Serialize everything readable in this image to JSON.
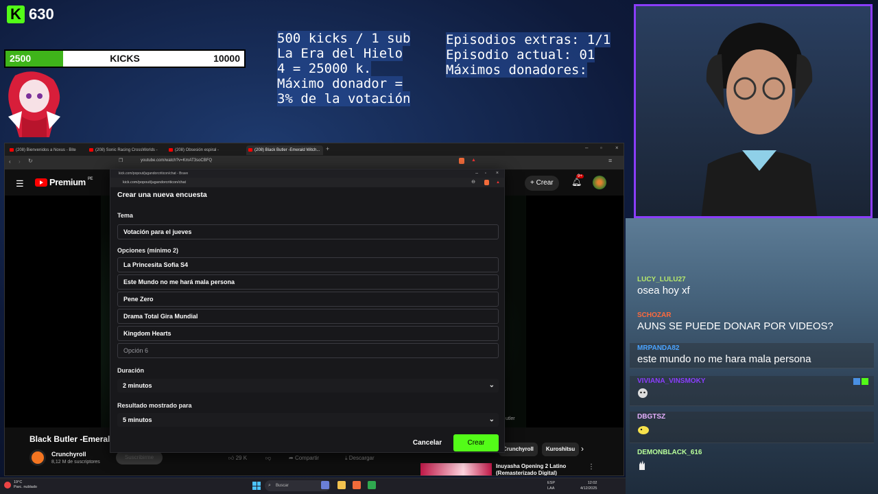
{
  "overlay": {
    "kick_count": "630",
    "goal": {
      "start": "2500",
      "label": "KICKS",
      "end": "10000",
      "progress": 0.24
    },
    "info_left": [
      "500 kicks / 1 sub",
      "La Era del Hielo",
      "4 = 25000 k.",
      "Máximo donador =",
      "3% de la votación"
    ],
    "info_right": [
      "Episodios extras: 1/1",
      "Episodio actual: 01",
      "Máximos donadores:"
    ]
  },
  "browser": {
    "tabs": [
      {
        "label": "(208) Bienvenidos a Noxus - Bite Me..."
      },
      {
        "label": "(208) Sonic Racing CrossWorlds - Co..."
      },
      {
        "label": "(208) Obsesión espiral - Frecuencia..."
      },
      {
        "label": "(208) Black Butler -Emerald Witch..."
      }
    ],
    "url": "youtube.com/watch?v=KmAT3soCBFQ"
  },
  "youtube": {
    "logo": "Premium",
    "logo_region": "PE",
    "create_label": "Crear",
    "notif_count": "9+",
    "video_title": "Black Butler -Emerald",
    "channel_name": "Crunchyroll",
    "channel_subs": "8,12 M de suscriptores",
    "subscribe_label": "Suscribirme",
    "likes": "29 K",
    "share_label": "Compartir",
    "download_label": "Descargar",
    "chips": [
      "Crunchyroll",
      "Kuroshitsu"
    ],
    "related_title": "Inuyasha Opening 2 Latino (Remasterizado Digital)",
    "video_side_text": "utler"
  },
  "popout": {
    "window_title": "kick.com/popout/jugandorcriticon/chat - Brave",
    "url": "kick.com/popout/jugandorcriticon/chat",
    "header": "Crear una nueva encuesta",
    "topic_label": "Tema",
    "topic_value": "Votación para el jueves",
    "options_label": "Opciones (mínimo 2)",
    "options": [
      "La Princesita Sofia S4",
      "Este Mundo no me hará mala persona",
      "Pene Zero",
      "Drama Total Gira Mundial",
      "Kingdom Hearts"
    ],
    "option_placeholder": "Opción 6",
    "duration_label": "Duración",
    "duration_value": "2 minutos",
    "result_label": "Resultado mostrado para",
    "result_value": "5 minutos",
    "cancel_label": "Cancelar",
    "create_label": "Crear"
  },
  "chat": {
    "messages": [
      {
        "user": "LUCY_LULU27",
        "text": "osea hoy xf",
        "color": "#b6e86b"
      },
      {
        "user": "SCHOZAR",
        "text": "AUNS SE PUEDE DONAR POR VIDEOS?",
        "color": "#ff6a3d"
      },
      {
        "user": "MRPANDA82",
        "text": "este mundo no me hara mala persona",
        "color": "#4aa3ff"
      },
      {
        "user": "VIVIANA_VINSMOKY",
        "text": "",
        "color": "#8b3dff"
      },
      {
        "user": "DBGTSZ",
        "text": "",
        "color": "#e6b0ff"
      },
      {
        "user": "DEMONBLACK_616",
        "text": "",
        "color": "#b8ff9a"
      }
    ]
  },
  "taskbar": {
    "weather_temp": "19°C",
    "weather_desc": "Parc. nublado",
    "search_placeholder": "Buscar",
    "lang": "ESP",
    "lang_sub": "LAA",
    "time": "12:02",
    "date": "4/12/2025"
  }
}
